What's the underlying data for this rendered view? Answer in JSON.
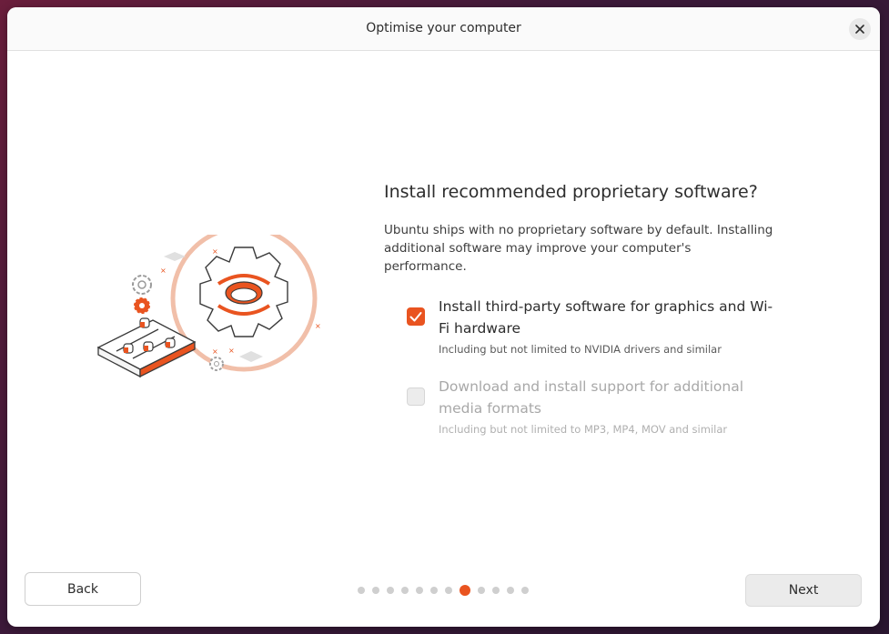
{
  "window": {
    "title": "Optimise your computer"
  },
  "main": {
    "heading": "Install recommended proprietary software?",
    "description": "Ubuntu ships with no proprietary software by default. Installing additional software may improve your computer's performance.",
    "options": [
      {
        "label": "Install third-party software for graphics and Wi-Fi hardware",
        "sublabel": "Including but not limited to NVIDIA drivers and similar",
        "checked": true,
        "enabled": true
      },
      {
        "label": "Download and install support for additional media formats",
        "sublabel": "Including but not limited to MP3, MP4, MOV and similar",
        "checked": false,
        "enabled": false
      }
    ]
  },
  "footer": {
    "back_label": "Back",
    "next_label": "Next",
    "progress": {
      "total_steps": 12,
      "current_step": 8
    }
  },
  "colors": {
    "accent": "#e95420",
    "background_gradient_start": "#6b1e3c",
    "background_gradient_end": "#2a1630"
  },
  "icons": {
    "close": "close-icon",
    "checkbox_checked": "checkmark-icon"
  }
}
